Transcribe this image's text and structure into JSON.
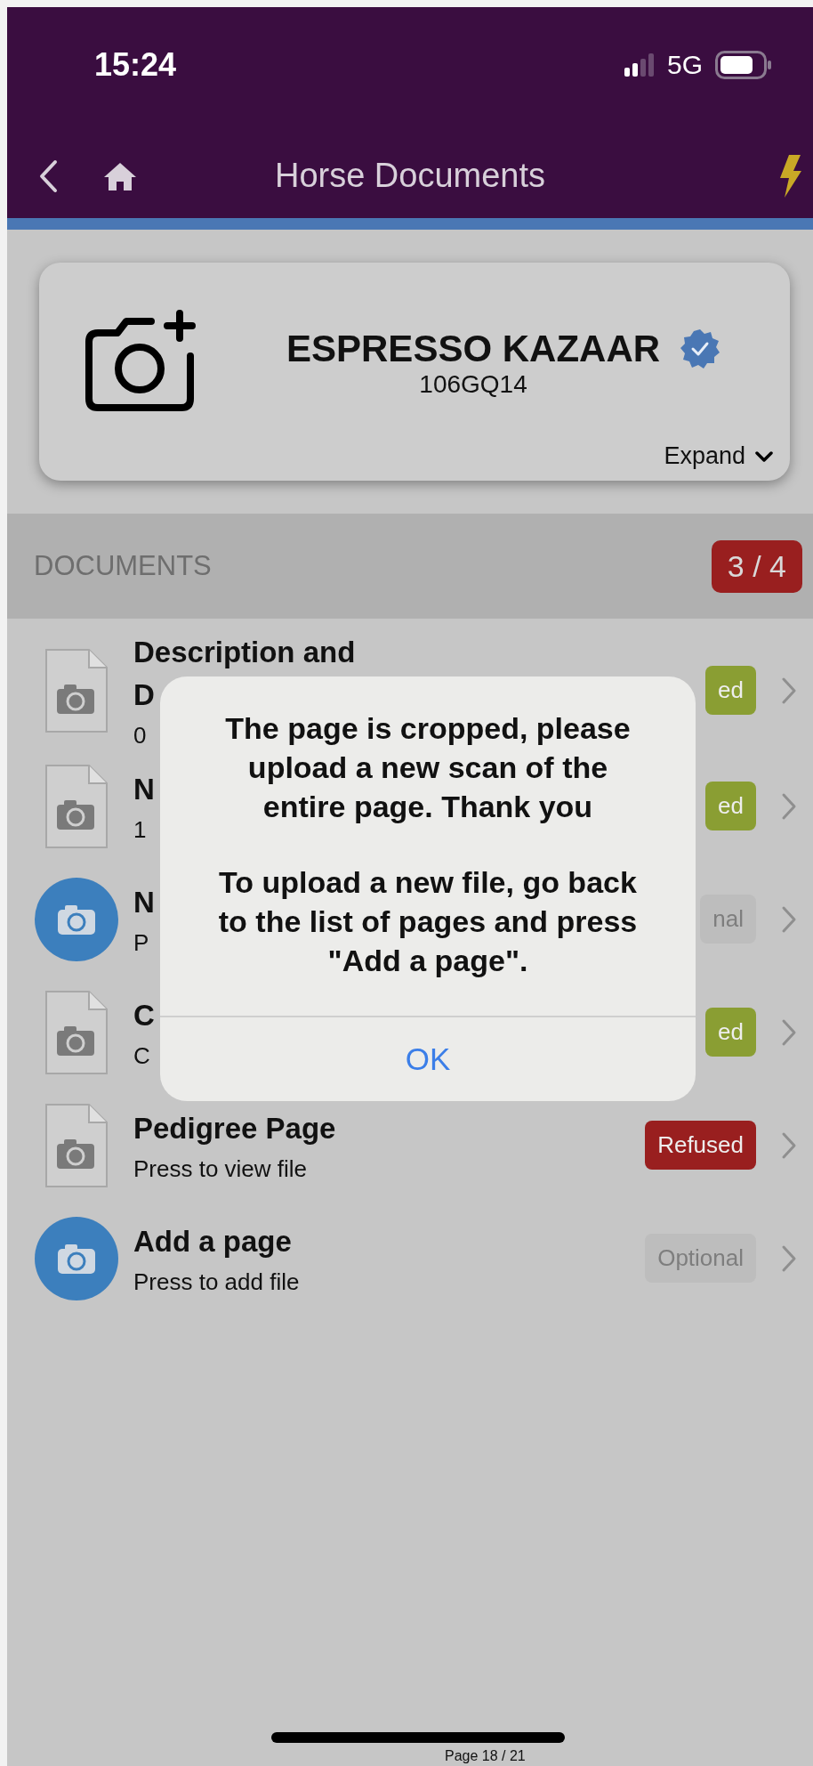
{
  "status_bar": {
    "time": "15:24",
    "network": "5G"
  },
  "nav": {
    "title": "Horse Documents"
  },
  "horse": {
    "name": "ESPRESSO KAZAAR",
    "verified": true,
    "code": "106GQ14",
    "expand_label": "Expand"
  },
  "documents": {
    "heading": "DOCUMENTS",
    "counter": "3 / 4",
    "rows": [
      {
        "kind": "file",
        "title_lines": [
          "Description and",
          "D"
        ],
        "subtitle": "0",
        "badge": {
          "label": "ed",
          "color": "#8a9e33"
        }
      },
      {
        "kind": "file",
        "title_lines": [
          "N"
        ],
        "subtitle": "1",
        "badge": {
          "label": "ed",
          "color": "#8a9e33"
        }
      },
      {
        "kind": "add",
        "title_lines": [
          "N"
        ],
        "subtitle": "P",
        "badge": {
          "label": "nal",
          "color": "#bdbdbd"
        }
      },
      {
        "kind": "file",
        "title_lines": [
          "C"
        ],
        "subtitle": "C",
        "badge": {
          "label": "ed",
          "color": "#8a9e33"
        }
      },
      {
        "kind": "file",
        "title_lines": [
          "Pedigree Page"
        ],
        "subtitle": "Press to view file",
        "badge": {
          "label": "Refused",
          "color": "#991f1f"
        }
      },
      {
        "kind": "add",
        "title_lines": [
          "Add a page"
        ],
        "subtitle": "Press to add file",
        "badge": {
          "label": "Optional",
          "color": "#bdbdbd"
        }
      }
    ]
  },
  "alert": {
    "paragraphs": [
      "The page is cropped, please upload a new scan of the entire page. Thank you",
      "To upload a new file, go back to the list of pages and press \"Add a page\"."
    ],
    "button": "OK"
  },
  "footer": {
    "page_label": "Page 18 / 21"
  }
}
